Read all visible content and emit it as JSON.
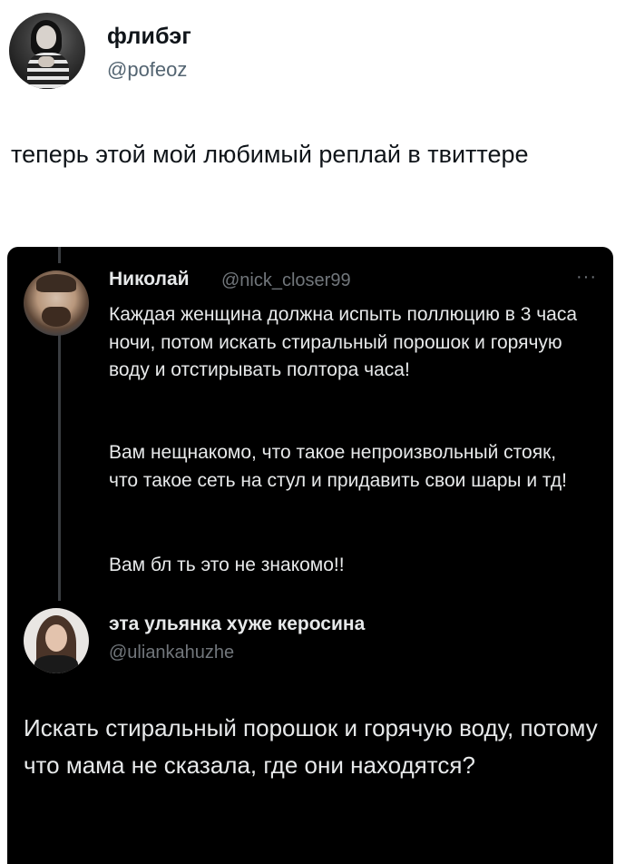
{
  "author": {
    "name": "флибэг",
    "handle": "@pofeoz"
  },
  "tweet": {
    "text": "теперь этой мой любимый реплай в твиттере"
  },
  "embedded": {
    "original": {
      "name": "Николай",
      "handle": "@nick_closer99",
      "more_label": "···",
      "paragraphs": [
        "Каждая женщина должна испыть поллюцию в 3 часа ночи, потом искать стиральный порошок и горячую воду и отстирывать полтора часа!",
        "Вам нещнакомо, что такое непроизвольный стояк, что такое сеть на стул и придавить свои шары и тд!",
        "Вам бл  ть это не знакомо!!"
      ]
    },
    "reply": {
      "name": "эта ульянка хуже керосина",
      "handle": "@uliankahuzhe",
      "text": "Искать стиральный порошок и горячую воду, потому что мама не сказала, где они находятся?"
    }
  }
}
